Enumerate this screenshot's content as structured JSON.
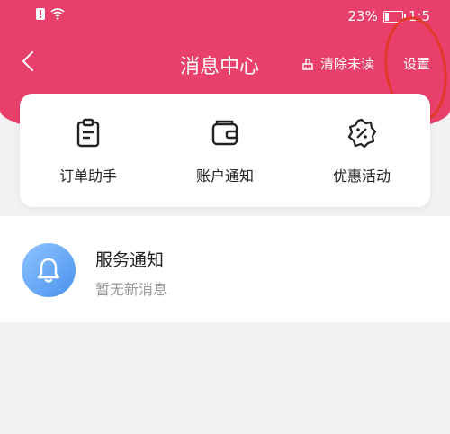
{
  "status_bar": {
    "battery": "23%",
    "time": "1:5",
    "icons": [
      "alert-icon",
      "wifi-icon",
      "battery-icon"
    ]
  },
  "header": {
    "title": "消息中心",
    "clear_label": "清除未读",
    "settings_label": "设置",
    "accent_color": "#e8406a",
    "annotation_color": "#e1392a"
  },
  "quick_entries": [
    {
      "label": "订单助手",
      "icon": "order-icon"
    },
    {
      "label": "账户通知",
      "icon": "wallet-icon"
    },
    {
      "label": "优惠活动",
      "icon": "discount-icon"
    }
  ],
  "notifications": [
    {
      "title": "服务通知",
      "subtitle": "暂无新消息",
      "icon": "bell-icon"
    }
  ]
}
